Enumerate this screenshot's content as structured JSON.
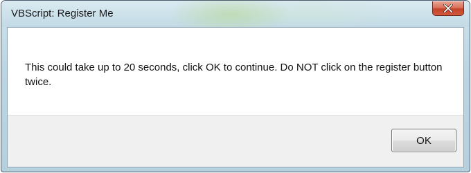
{
  "window": {
    "title": "VBScript: Register Me",
    "close_icon": "close-icon"
  },
  "dialog": {
    "message": "This could take up to 20 seconds, click OK to continue.  Do NOT click on the register button twice.",
    "ok_label": "OK"
  },
  "colors": {
    "close_button": "#c4432b",
    "titlebar": "#cfe3ec",
    "footer": "#f0f0f0"
  }
}
